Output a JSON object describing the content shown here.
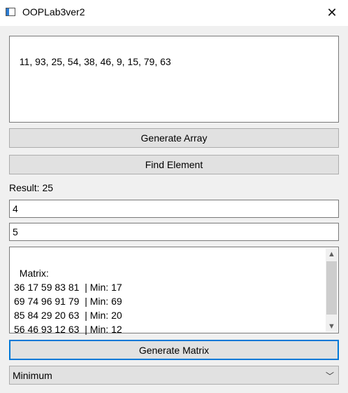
{
  "window": {
    "title": "OOPLab3ver2",
    "close_glyph": "✕"
  },
  "array_output": {
    "text": "11, 93, 25, 54, 38, 46, 9, 15, 79, 63"
  },
  "buttons": {
    "generate_array": "Generate Array",
    "find_element": "Find Element",
    "generate_matrix": "Generate Matrix"
  },
  "result_label": "Result: 25",
  "inputs": {
    "rows": "4",
    "cols": "5"
  },
  "matrix_output": {
    "lines": "Matrix:\n36 17 59 83 81  | Min: 17\n69 74 96 91 79  | Min: 69\n85 84 29 20 63  | Min: 20\n56 46 93 12 63  | Min: 12"
  },
  "mode_select": {
    "selected": "Minimum"
  },
  "icons": {
    "scroll_up": "▲",
    "scroll_down": "▼",
    "dropdown": "﹀"
  }
}
